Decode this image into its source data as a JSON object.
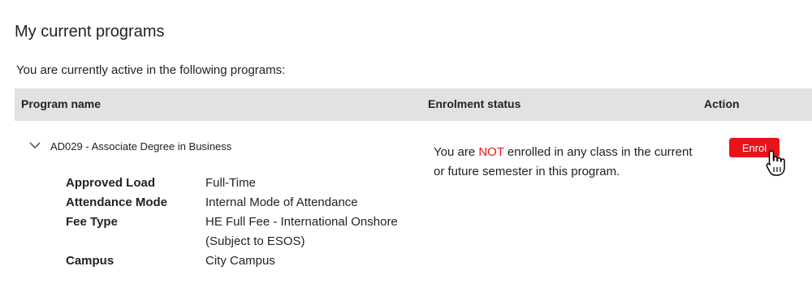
{
  "page": {
    "title": "My current programs",
    "intro": "You are currently active in the following programs:"
  },
  "table": {
    "headers": {
      "program_name": "Program name",
      "enrolment_status": "Enrolment status",
      "action": "Action"
    }
  },
  "program": {
    "title": "AD029 - Associate Degree in Business",
    "details": [
      {
        "label": "Approved Load",
        "value": "Full-Time"
      },
      {
        "label": "Attendance Mode",
        "value": "Internal Mode of Attendance"
      },
      {
        "label": "Fee Type",
        "value": "HE Full Fee - International Onshore (Subject to ESOS)"
      },
      {
        "label": "Campus",
        "value": "City Campus"
      }
    ],
    "status_before": "You are ",
    "status_highlight": "NOT",
    "status_after": " enrolled in any class in the current or future semester in this program.",
    "action_label": "Enrol"
  },
  "colors": {
    "accent_red": "#e8141b",
    "header_bg": "#e2e2e2"
  },
  "icons": {
    "expand": "chevron-down-icon",
    "cursor": "hand-pointer-icon"
  }
}
